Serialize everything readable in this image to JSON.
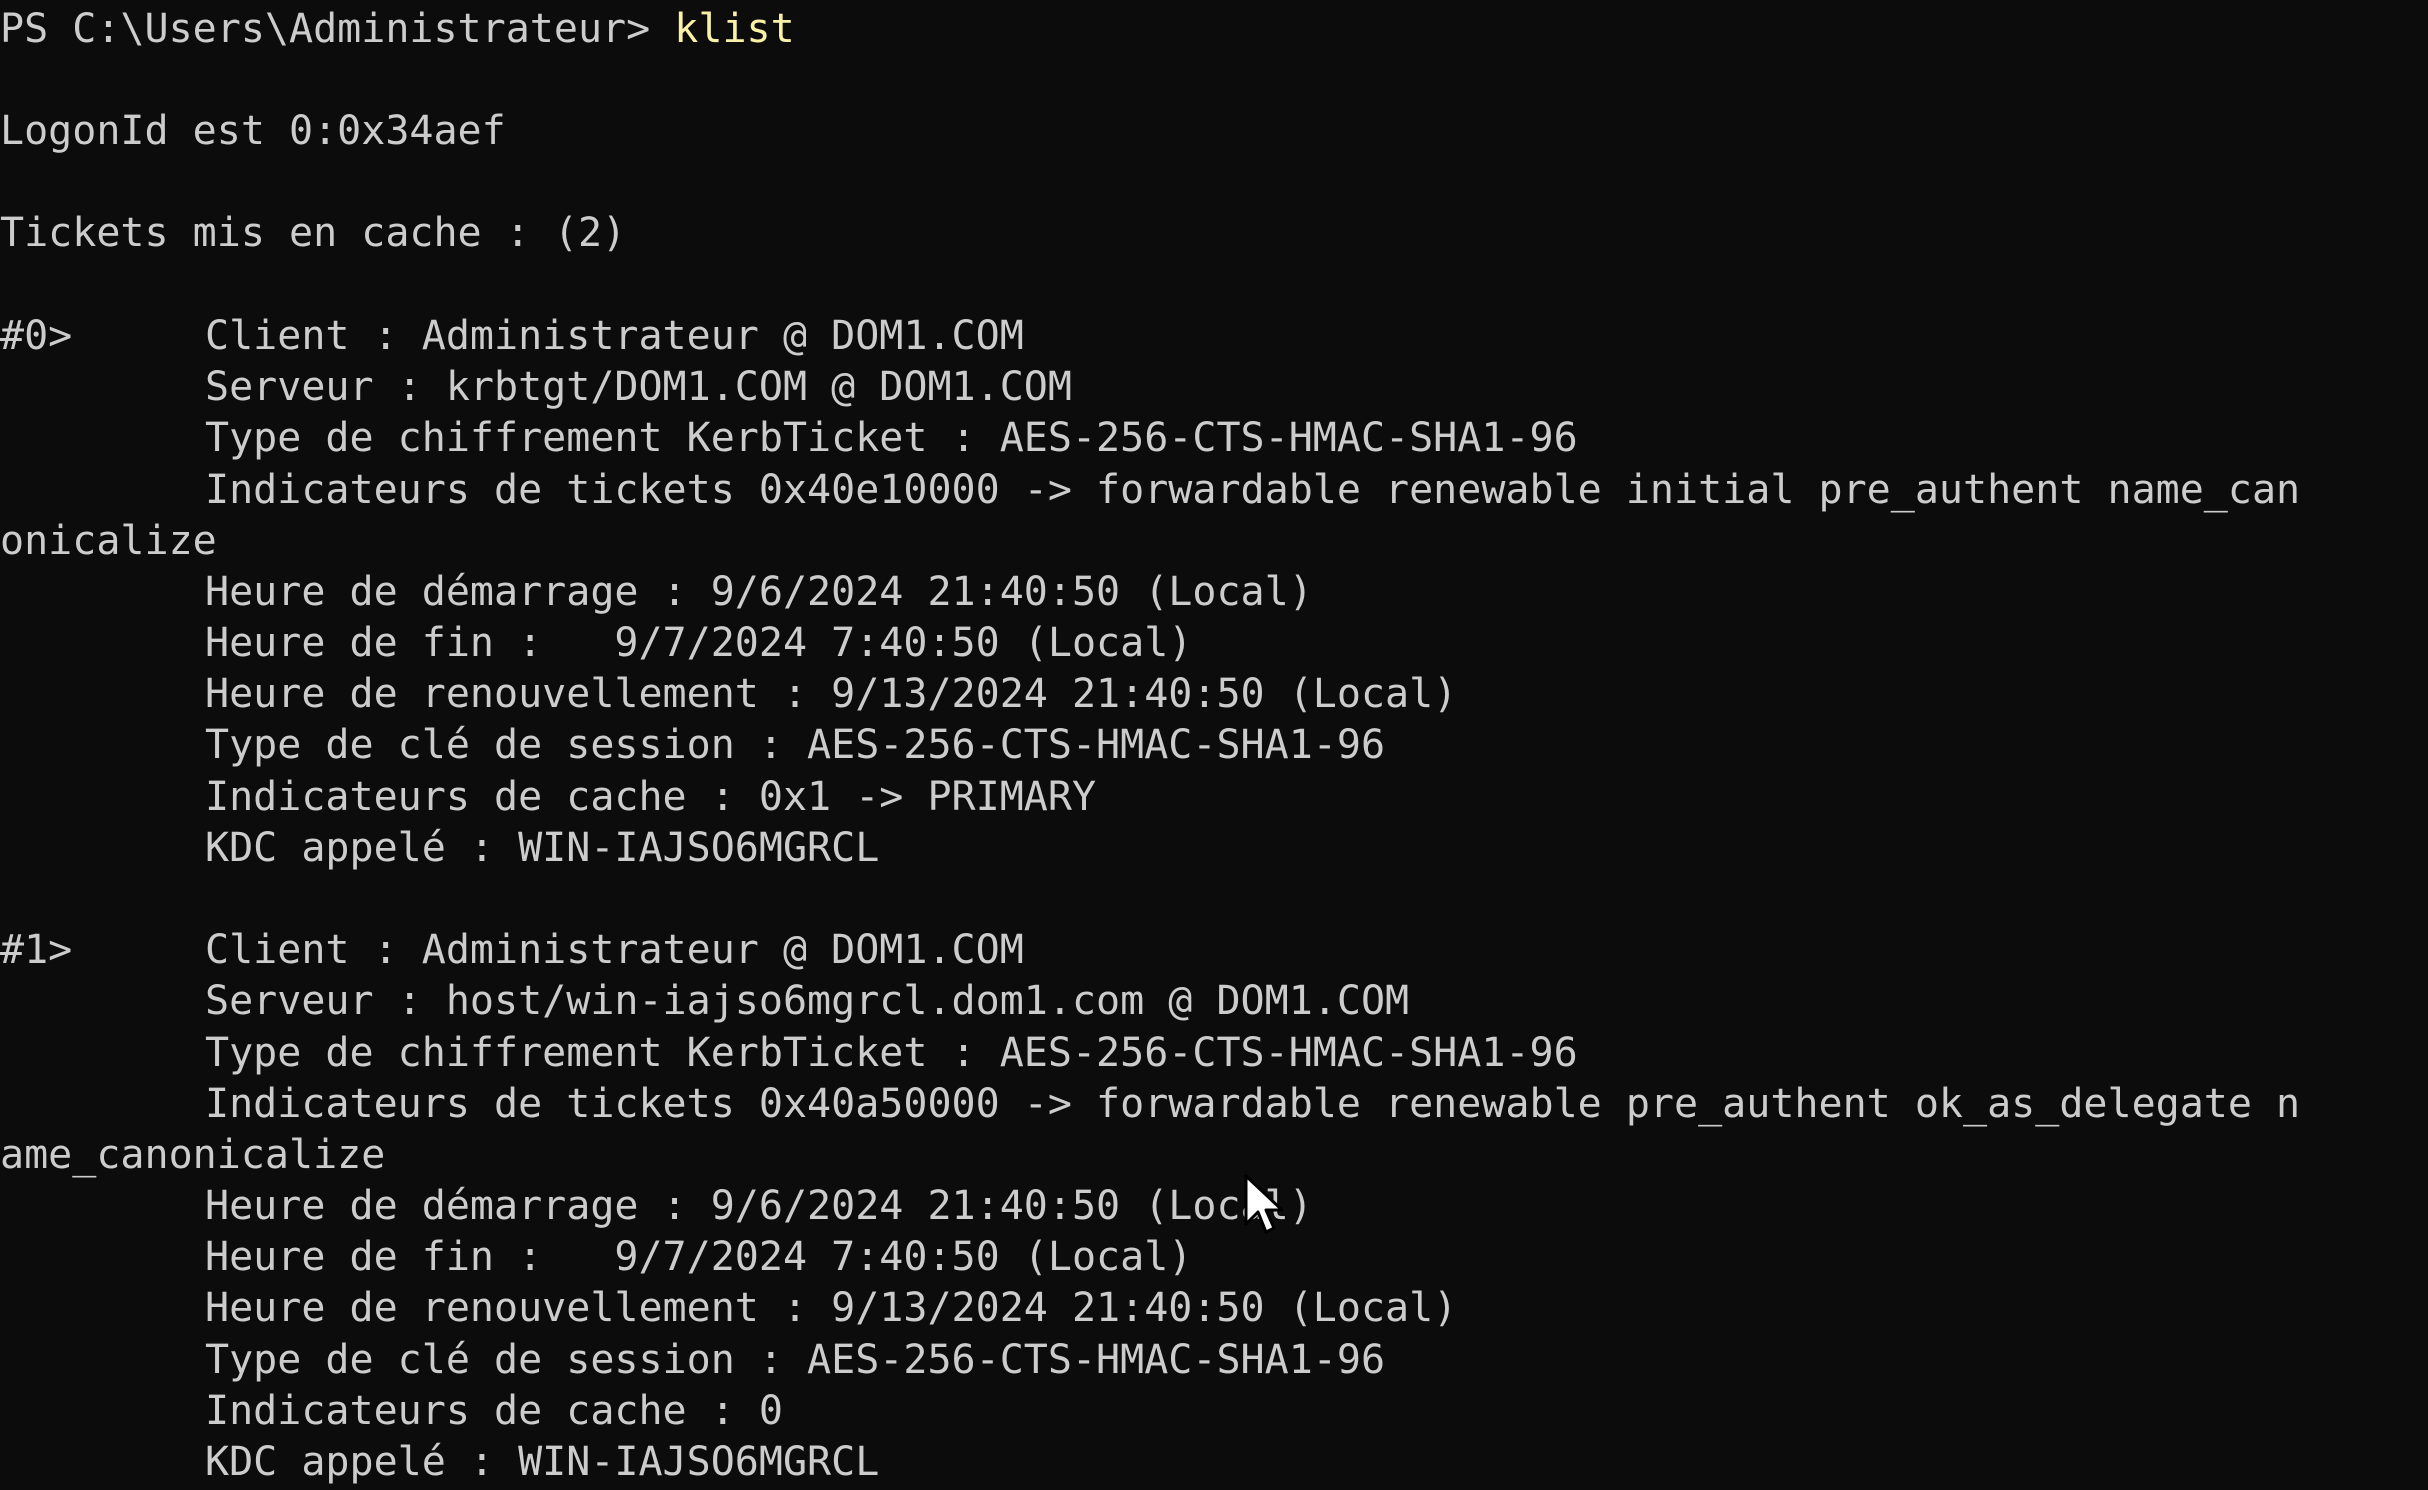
{
  "terminal": {
    "prompt": "PS C:\\Users\\Administrateur> ",
    "command": "klist",
    "logon_line": "LogonId est 0:0x34aef",
    "cached_line": "Tickets mis en cache : (2)",
    "tickets": [
      {
        "index_label": "#0>",
        "client": "Client : Administrateur @ DOM1.COM",
        "server": "Serveur : krbtgt/DOM1.COM @ DOM1.COM",
        "enc_type": "Type de chiffrement KerbTicket : AES-256-CTS-HMAC-SHA1-96",
        "flags_part1": "Indicateurs de tickets 0x40e10000 -> forwardable renewable initial pre_authent name_can",
        "flags_part2": "onicalize",
        "start_time": "Heure de démarrage : 9/6/2024 21:40:50 (Local)",
        "end_time": "Heure de fin :   9/7/2024 7:40:50 (Local)",
        "renew_time": "Heure de renouvellement : 9/13/2024 21:40:50 (Local)",
        "session_key_type": "Type de clé de session : AES-256-CTS-HMAC-SHA1-96",
        "cache_flags": "Indicateurs de cache : 0x1 -> PRIMARY",
        "kdc_called": "KDC appelé : WIN-IAJSO6MGRCL"
      },
      {
        "index_label": "#1>",
        "client": "Client : Administrateur @ DOM1.COM",
        "server": "Serveur : host/win-iajso6mgrcl.dom1.com @ DOM1.COM",
        "enc_type": "Type de chiffrement KerbTicket : AES-256-CTS-HMAC-SHA1-96",
        "flags_part1": "Indicateurs de tickets 0x40a50000 -> forwardable renewable pre_authent ok_as_delegate n",
        "flags_part2": "ame_canonicalize",
        "start_time": "Heure de démarrage : 9/6/2024 21:40:50 (Local)",
        "end_time": "Heure de fin :   9/7/2024 7:40:50 (Local)",
        "renew_time": "Heure de renouvellement : 9/13/2024 21:40:50 (Local)",
        "session_key_type": "Type de clé de session : AES-256-CTS-HMAC-SHA1-96",
        "cache_flags": "Indicateurs de cache : 0",
        "kdc_called": "KDC appelé : WIN-IAJSO6MGRCL"
      }
    ],
    "colors": {
      "background": "#0c0c0c",
      "text": "#cccccc",
      "command": "#f9f1a5"
    },
    "icons": {
      "cursor": "mouse-pointer-icon"
    }
  }
}
